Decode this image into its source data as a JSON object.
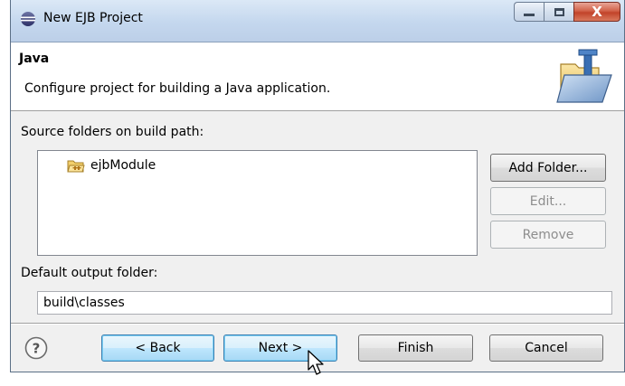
{
  "window": {
    "title": "New EJB Project",
    "buttons": {
      "minimize": "minimize",
      "maximize": "maximize",
      "close": "X"
    }
  },
  "header": {
    "title": "Java",
    "description": "Configure project for building a Java application."
  },
  "source_folders": {
    "label": "Source folders on build path:",
    "items": [
      {
        "label": "ejbModule",
        "icon": "package-folder-icon"
      }
    ],
    "buttons": {
      "add_folder": "Add Folder...",
      "edit": "Edit...",
      "remove": "Remove"
    }
  },
  "output_folder": {
    "label": "Default output folder:",
    "value": "build\\classes"
  },
  "footer": {
    "help_icon": "help-icon",
    "back": "< Back",
    "next": "Next >",
    "finish": "Finish",
    "cancel": "Cancel"
  },
  "colors": {
    "titlebar": "#c4d7ee",
    "close_button": "#c2432a",
    "focused_button": "#bee6fd",
    "dialog_background": "#f0f0f0"
  }
}
